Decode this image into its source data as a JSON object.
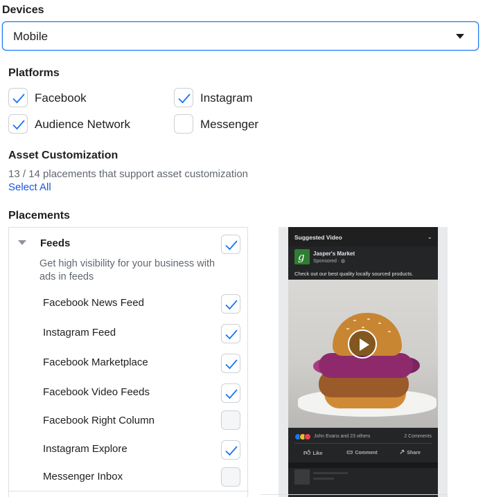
{
  "devices": {
    "label": "Devices",
    "selected": "Mobile"
  },
  "platforms": {
    "label": "Platforms",
    "items": [
      {
        "label": "Facebook",
        "checked": true
      },
      {
        "label": "Instagram",
        "checked": true
      },
      {
        "label": "Audience Network",
        "checked": true
      },
      {
        "label": "Messenger",
        "checked": false
      }
    ]
  },
  "asset_customization": {
    "label": "Asset Customization",
    "summary": "13 / 14 placements that support asset customization",
    "select_all": "Select All"
  },
  "placements": {
    "label": "Placements",
    "group": {
      "title": "Feeds",
      "description": "Get high visibility for your business with ads in feeds",
      "checked": true,
      "items": [
        {
          "label": "Facebook News Feed",
          "checked": true
        },
        {
          "label": "Instagram Feed",
          "checked": true
        },
        {
          "label": "Facebook Marketplace",
          "checked": true
        },
        {
          "label": "Facebook Video Feeds",
          "checked": true
        },
        {
          "label": "Facebook Right Column",
          "checked": false
        },
        {
          "label": "Instagram Explore",
          "checked": true
        },
        {
          "label": "Messenger Inbox",
          "checked": false
        }
      ]
    }
  },
  "preview": {
    "header": "Suggested Video",
    "page_name": "Jasper's Market",
    "sponsored": "Sponsored · ",
    "caption": "Check out our best quality locally sourced products.",
    "reactions_text": "John Evans and 23 others",
    "comments_text": "2 Comments",
    "actions": {
      "like": "Like",
      "comment": "Comment",
      "share": "Share"
    }
  },
  "colors": {
    "accent": "#1877f2",
    "check": "#1877f2"
  }
}
